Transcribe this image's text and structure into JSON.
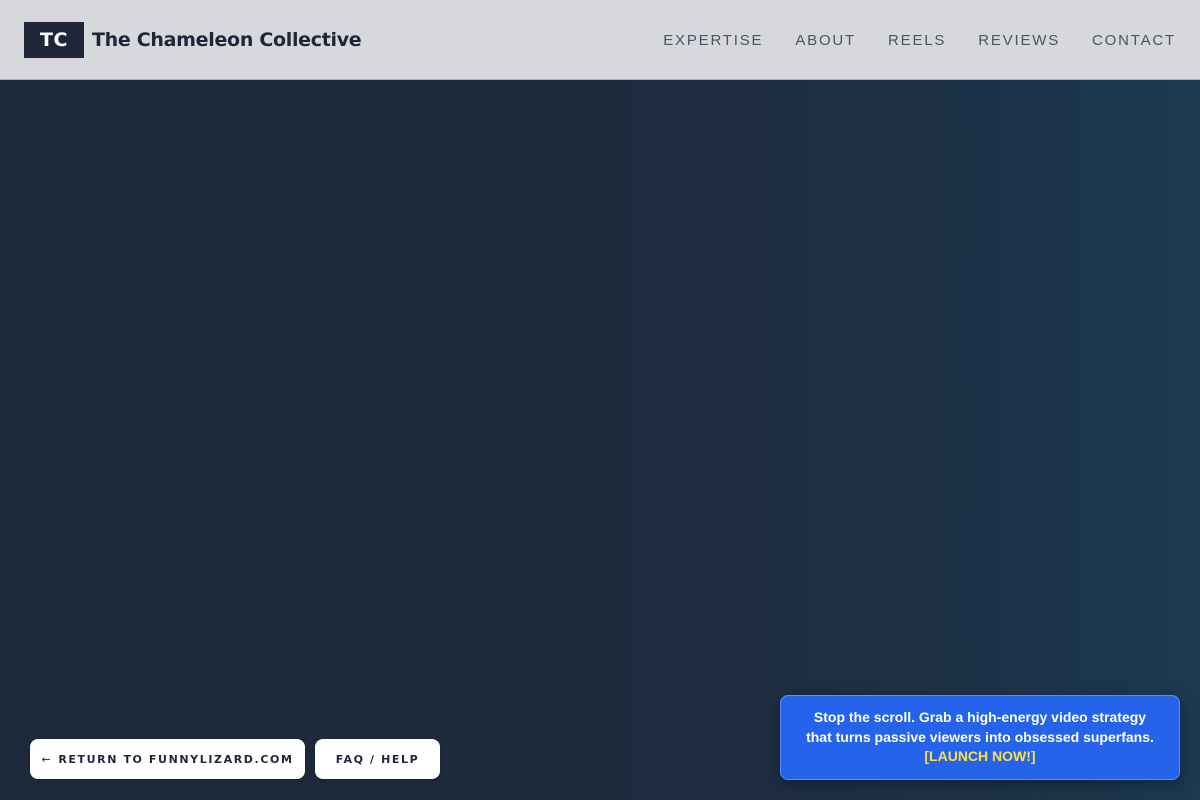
{
  "header": {
    "logo_text": "TC",
    "brand_name": "The Chameleon Collective",
    "nav": [
      {
        "label": "EXPERTISE"
      },
      {
        "label": "ABOUT"
      },
      {
        "label": "REELS"
      },
      {
        "label": "REVIEWS"
      },
      {
        "label": "CONTACT"
      }
    ]
  },
  "footer_buttons": {
    "return_icon": "←",
    "return_label": "RETURN TO FUNNYLIZARD.COM",
    "faq_label": "FAQ / HELP"
  },
  "promo": {
    "line1": "Stop the scroll. Grab a high-energy video strategy",
    "line2": "that turns passive viewers into obsessed superfans.",
    "cta": "[LAUNCH NOW!]"
  },
  "colors": {
    "header_bg": "#d6d8dc",
    "page_bg": "#1f2a3d",
    "promo_bg": "#2563eb",
    "cta_color": "#fde047"
  }
}
